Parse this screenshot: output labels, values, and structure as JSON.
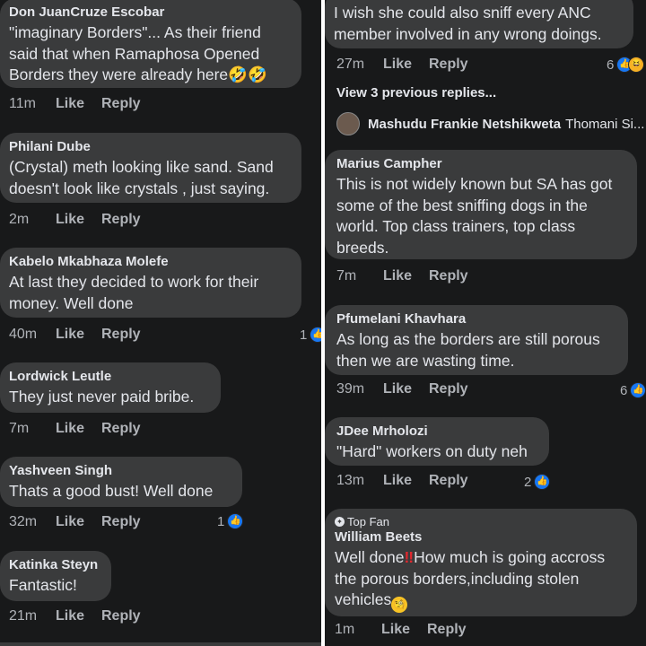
{
  "actions": {
    "like": "Like",
    "reply": "Reply"
  },
  "left": {
    "comments": [
      {
        "author": "Don JuanCruze Escobar",
        "text": "\"imaginary Borders\"... As their friend said that when Ramaphosa Opened Borders they were already here",
        "emoji": "🤣🤣",
        "time": "11m"
      },
      {
        "author": "Philani Dube",
        "text": "(Crystal) meth looking like sand. Sand doesn't look like crystals , just saying.",
        "time": "2m"
      },
      {
        "author": "Kabelo Mkabhaza Molefe",
        "text": "At last they decided to work for their money. Well done",
        "time": "40m",
        "reactions": "1"
      },
      {
        "author": "Lordwick Leutle",
        "text": "They just never paid bribe.",
        "time": "7m"
      },
      {
        "author": "Yashveen Singh",
        "text": "Thats a good bust! Well done",
        "time": "32m",
        "reactions": "1"
      },
      {
        "author": "Katinka Steyn",
        "text": "Fantastic!",
        "time": "21m"
      }
    ]
  },
  "right": {
    "comments": [
      {
        "author": "",
        "text": "I wish she could also sniff every ANC member involved in any wrong doings.",
        "time": "27m",
        "reactions": "6"
      },
      {
        "author": "Marius Campher",
        "text": "This is not widely known but SA has got some of the best sniffing dogs in the world. Top class trainers, top class breeds.",
        "time": "7m"
      },
      {
        "author": "Pfumelani Khavhara",
        "text": "As long as the borders are still porous then we are wasting time.",
        "time": "39m",
        "reactions": "6"
      },
      {
        "author": "JDee Mrholozi",
        "text": "\"Hard\" workers on duty neh",
        "time": "13m",
        "reactions": "2"
      },
      {
        "author": "William Beets",
        "badge": "Top Fan",
        "text_a": "Well done",
        "text_b": "How much is going accross the porous borders,including stolen vehicles",
        "time": "1m"
      }
    ],
    "view_previous": "View 3 previous replies...",
    "reply_preview": {
      "name": "Mashudu Frankie Netshikweta",
      "text": "Thomani Si..."
    }
  }
}
